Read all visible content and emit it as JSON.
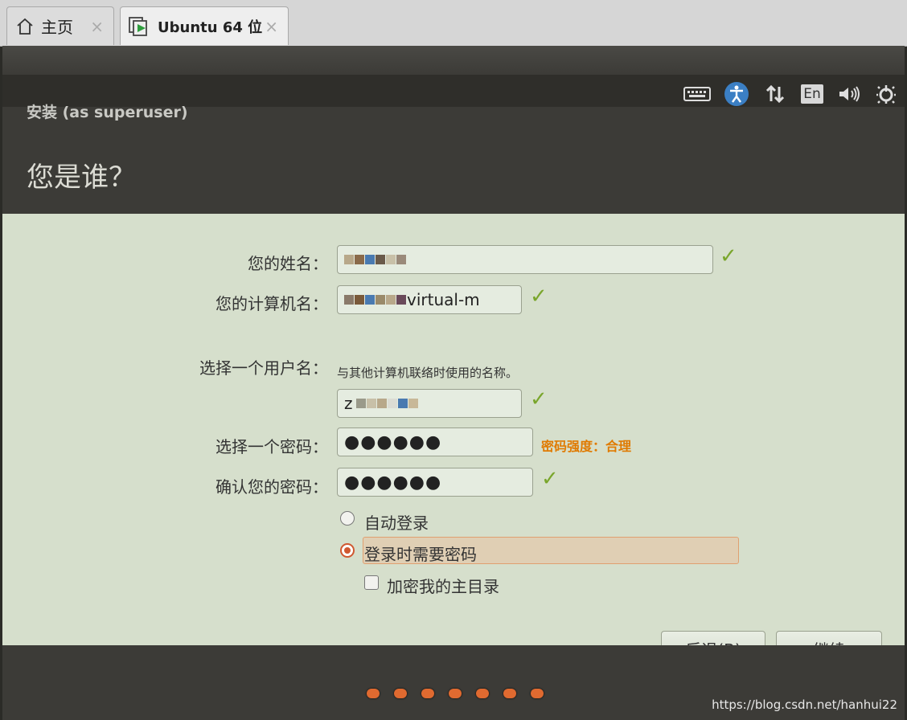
{
  "tabs": [
    {
      "label": "主页",
      "icon": "home-icon",
      "close": "×"
    },
    {
      "label": "Ubuntu 64 位",
      "icon": "vm-play-icon",
      "close": "×"
    }
  ],
  "indicators": [
    "keyboard-icon",
    "accessibility-icon",
    "network-icon",
    "En",
    "volume-icon",
    "power-icon"
  ],
  "installer": {
    "title": "安装 (as superuser)",
    "page_title": "您是谁？"
  },
  "form": {
    "name_label": "您的姓名：",
    "computer_label": "您的计算机名：",
    "computer_value_suffix": "virtual-m",
    "computer_hint": "与其他计算机联络时使用的名称。",
    "username_label": "选择一个用户名：",
    "username_value_prefix": "z",
    "password_label": "选择一个密码：",
    "password_value": "●●●●●●",
    "password_strength": "密码强度：合理",
    "confirm_label": "确认您的密码：",
    "confirm_value": "●●●●●●",
    "option_auto_login": "自动登录",
    "option_require_password": "登录时需要密码",
    "option_encrypt_home": "加密我的主目录",
    "check_mark": "✓"
  },
  "buttons": {
    "back": "后退(B)",
    "continue": "继续"
  },
  "progress": {
    "current": 7,
    "total": 7
  },
  "watermark": "https://blog.csdn.net/hanhui22",
  "colors": {
    "accent": "#d05830",
    "check": "#7aa62c",
    "strength": "#e07a00"
  }
}
